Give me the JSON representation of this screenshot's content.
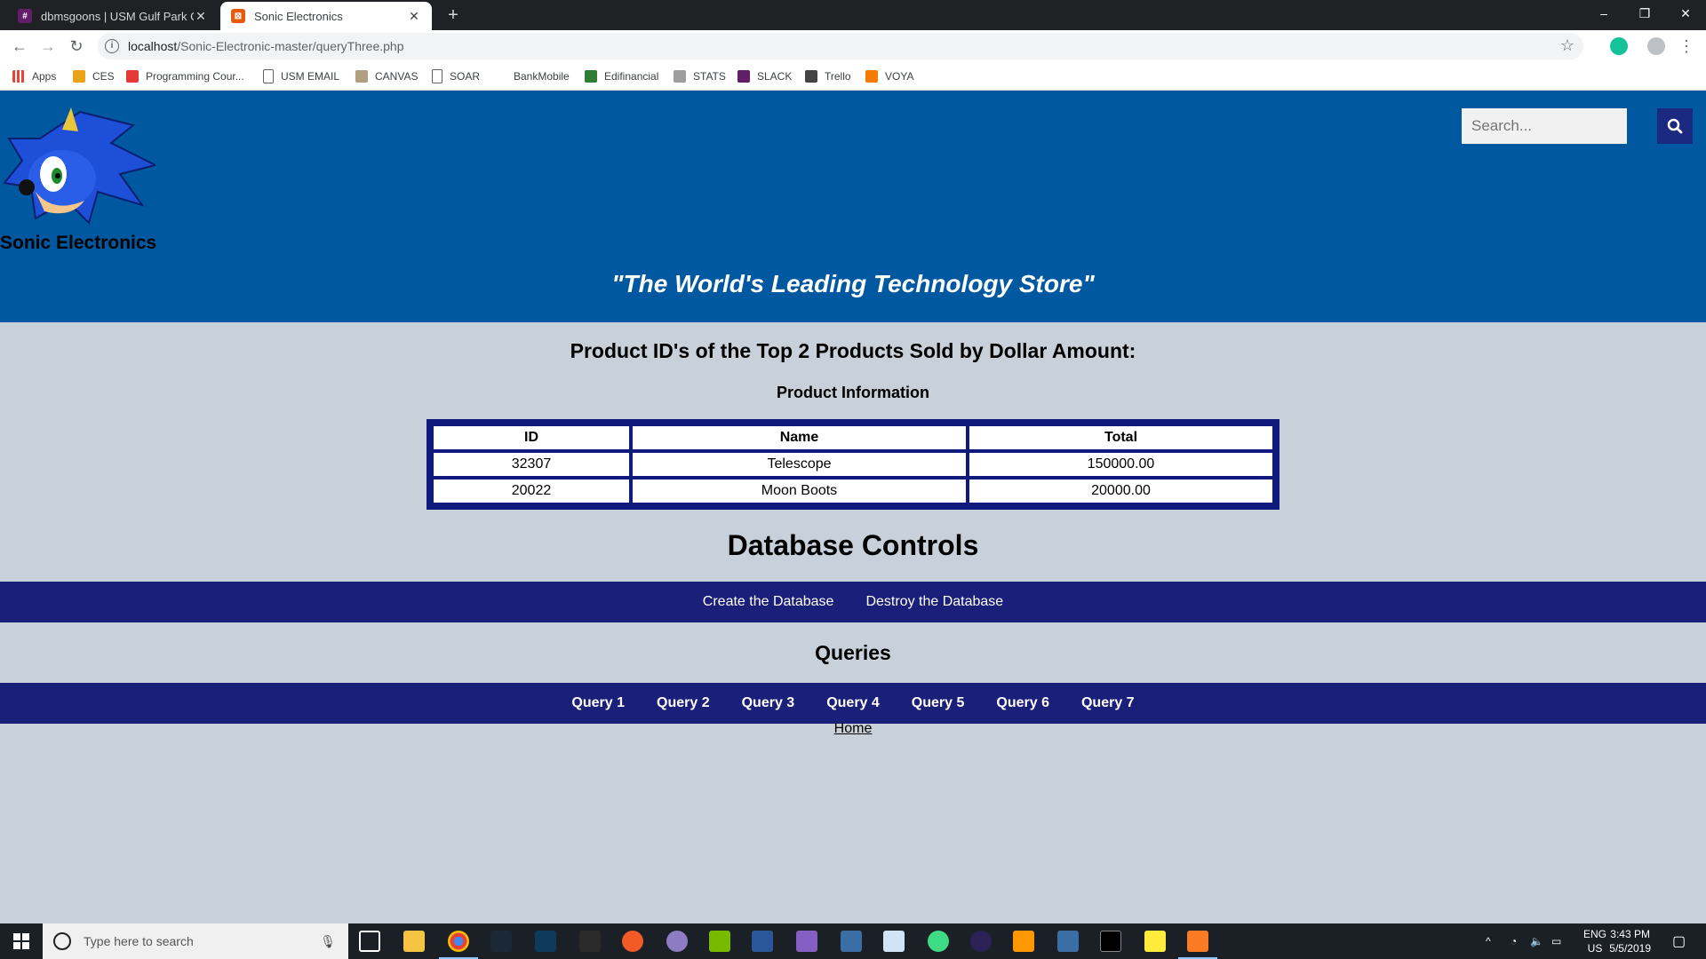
{
  "browser": {
    "tabs": [
      {
        "title": "dbmsgoons | USM Gulf Park Con"
      },
      {
        "title": "Sonic Electronics"
      }
    ],
    "url_host": "localhost",
    "url_path": "/Sonic-Electronic-master/queryThree.php",
    "window_controls": {
      "minimize": "–",
      "restore": "❐",
      "close": "✕"
    },
    "bookmarks": [
      {
        "label": "Apps",
        "icon": "apps-grid-icon"
      },
      {
        "label": "CES",
        "icon": "ces-icon"
      },
      {
        "label": "Programming Cour...",
        "icon": "programming-icon"
      },
      {
        "label": "USM EMAIL",
        "icon": "page-icon"
      },
      {
        "label": "CANVAS",
        "icon": "canvas-icon"
      },
      {
        "label": "SOAR",
        "icon": "page-icon"
      },
      {
        "label": "BankMobile",
        "icon": "blank"
      },
      {
        "label": "Edifinancial",
        "icon": "edifinancial-icon"
      },
      {
        "label": "STATS",
        "icon": "stats-icon"
      },
      {
        "label": "SLACK",
        "icon": "slack-icon"
      },
      {
        "label": "Trello",
        "icon": "trello-icon"
      },
      {
        "label": "VOYA",
        "icon": "voya-icon"
      }
    ]
  },
  "site": {
    "brand": "Sonic Electronics",
    "slogan": "\"The World's Leading Technology Store\"",
    "search_placeholder": "Search...",
    "header_color": "#0059a0",
    "nav_color": "#1a1f7a"
  },
  "main": {
    "heading": "Product ID's of the Top 2 Products Sold by Dollar Amount:",
    "table_caption": "Product Information",
    "table": {
      "headers": [
        "ID",
        "Name",
        "Total"
      ],
      "rows": [
        [
          "32307",
          "Telescope",
          "150000.00"
        ],
        [
          "20022",
          "Moon Boots",
          "20000.00"
        ]
      ]
    },
    "db_heading": "Database Controls",
    "db_controls": [
      "Create the Database",
      "Destroy the Database"
    ],
    "queries_heading": "Queries",
    "queries": [
      "Query 1",
      "Query 2",
      "Query 3",
      "Query 4",
      "Query 5",
      "Query 6",
      "Query 7"
    ],
    "home_link": "Home"
  },
  "taskbar": {
    "search_placeholder": "Type here to search",
    "lang_top": "ENG",
    "lang_bottom": "US",
    "time": "3:43 PM",
    "date": "5/5/2019"
  }
}
